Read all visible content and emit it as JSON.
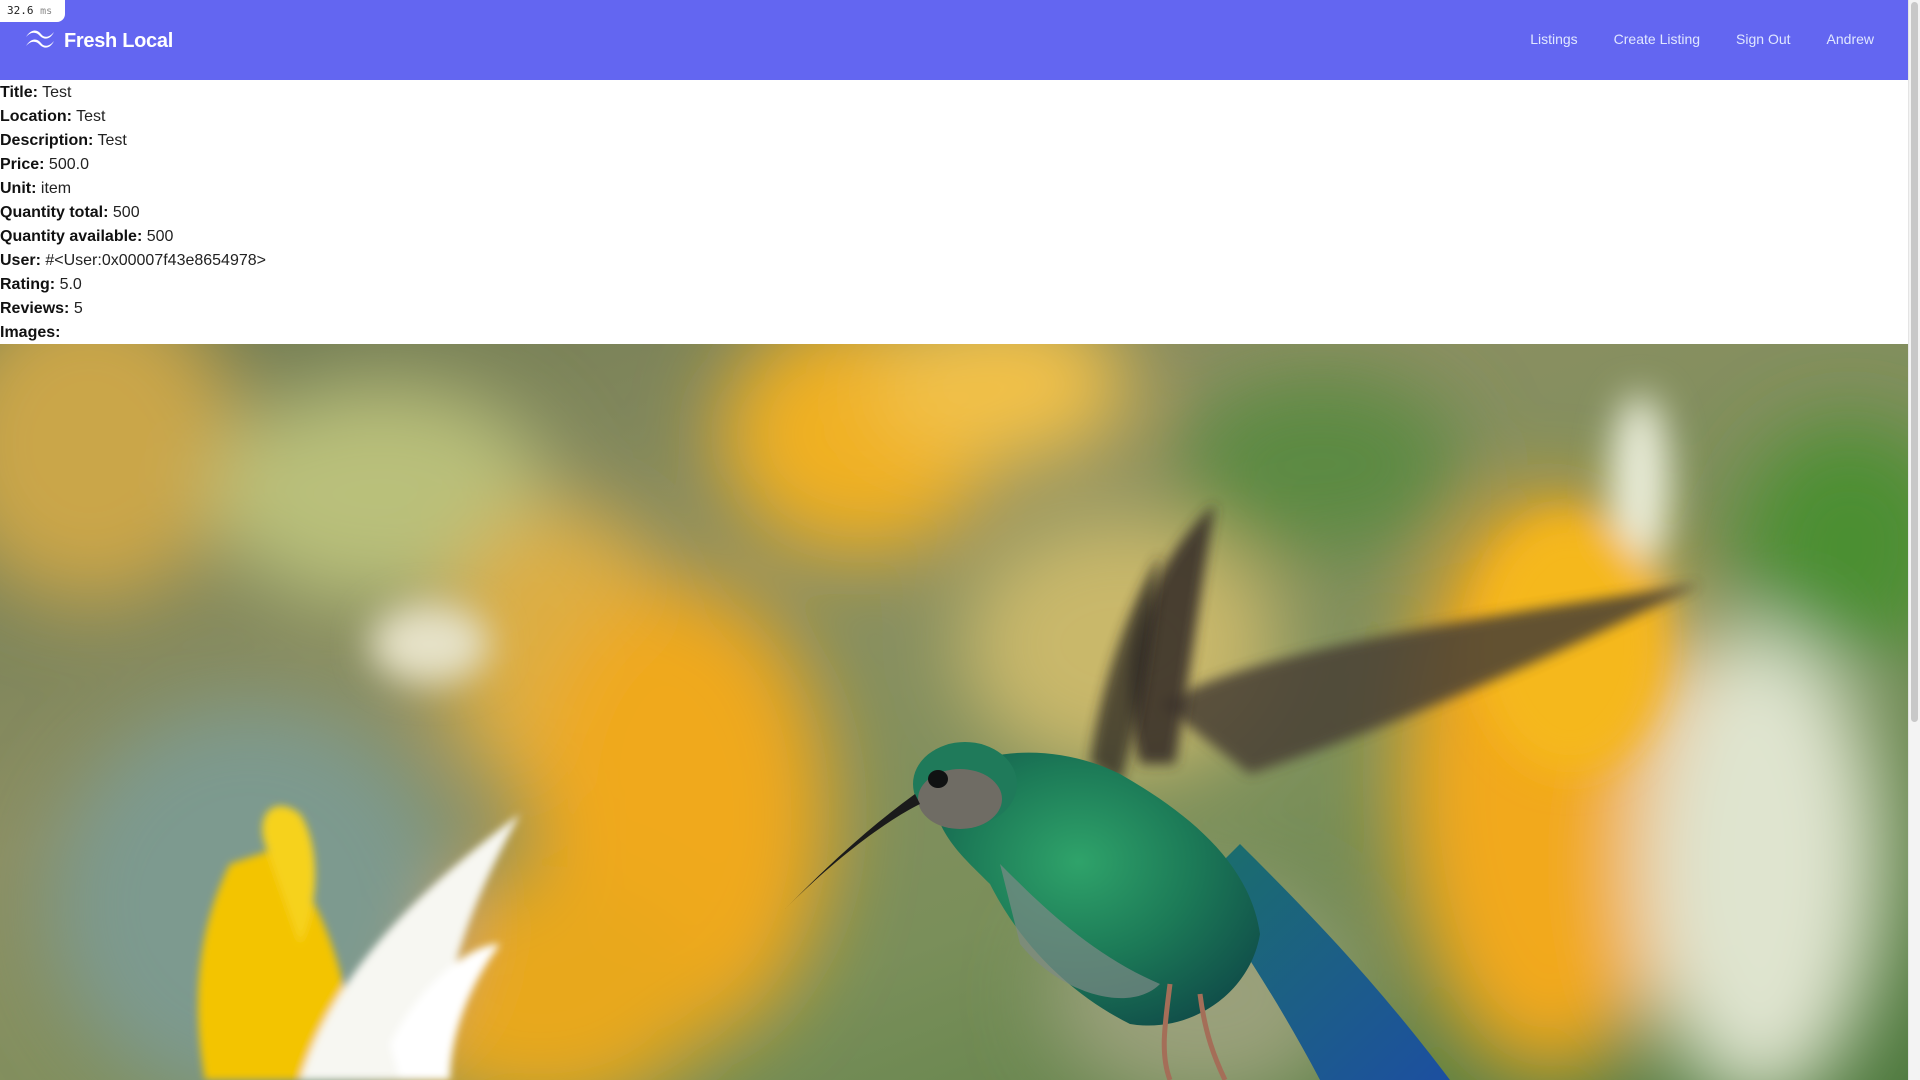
{
  "perf": {
    "value": "32.6",
    "unit": "ms"
  },
  "brand": {
    "name": "Fresh Local",
    "logo_icon": "wave-logo-icon"
  },
  "nav": {
    "items": [
      {
        "label": "Listings"
      },
      {
        "label": "Create Listing"
      },
      {
        "label": "Sign Out"
      },
      {
        "label": "Andrew"
      }
    ]
  },
  "listing": {
    "fields": [
      {
        "label": "Title:",
        "value": "Test"
      },
      {
        "label": "Location:",
        "value": "Test"
      },
      {
        "label": "Description:",
        "value": "Test"
      },
      {
        "label": "Price:",
        "value": "500.0"
      },
      {
        "label": "Unit:",
        "value": "item"
      },
      {
        "label": "Quantity total:",
        "value": "500"
      },
      {
        "label": "Quantity available:",
        "value": "500"
      },
      {
        "label": "User:",
        "value": "#<User:0x00007f43e8654978>"
      },
      {
        "label": "Rating:",
        "value": "5.0"
      },
      {
        "label": "Reviews:",
        "value": "5"
      },
      {
        "label": "Images:",
        "value": ""
      }
    ]
  },
  "colors": {
    "nav_bg": "#6366f1",
    "nav_text": "#e0e7ff",
    "brand_text": "#ffffff"
  }
}
